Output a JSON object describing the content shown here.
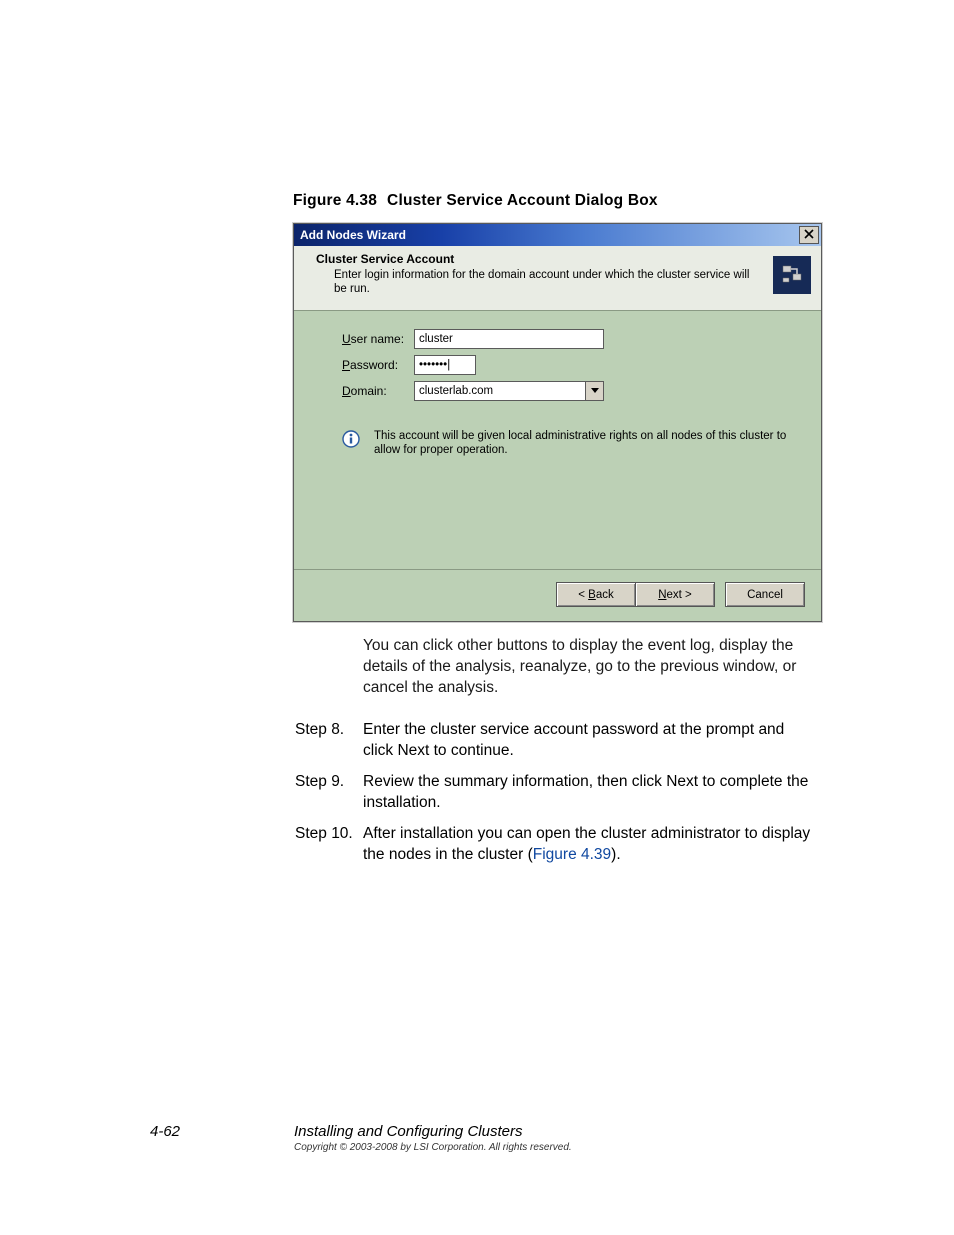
{
  "figure_caption_prefix": "Figure 4.38",
  "figure_caption_title": "Cluster Service Account Dialog Box",
  "dialog": {
    "title": "Add Nodes Wizard",
    "header_title": "Cluster Service Account",
    "header_subtitle": "Enter login information for the domain account under which the cluster service will be run.",
    "labels": {
      "username": "User name:",
      "password": "Password:",
      "domain": "Domain:"
    },
    "values": {
      "username": "cluster",
      "password": "•••••••",
      "domain": "clusterlab.com"
    },
    "info_note": "This account will be given local administrative rights on all nodes of this cluster to allow for proper operation.",
    "buttons": {
      "back": "< Back",
      "next": "Next >",
      "cancel": "Cancel"
    }
  },
  "paragraph_after": "You can click other buttons to display the event log, display the details of the analysis, reanalyze, go to the previous window, or cancel the analysis.",
  "steps": {
    "s8_label": "Step 8.",
    "s8_text": "Enter the cluster service account password at the prompt and click Next to continue.",
    "s9_label": "Step 9.",
    "s9_text": "Review the summary information, then click Next to complete the installation.",
    "s10_label": "Step 10.",
    "s10_text_a": "After installation you can open the cluster administrator to display the nodes in the cluster (",
    "s10_link": "Figure 4.39",
    "s10_text_b": ")."
  },
  "footer": {
    "page_num": "4-62",
    "section_title": "Installing and Configuring Clusters",
    "copyright": "Copyright © 2003-2008 by LSI Corporation. All rights reserved."
  }
}
